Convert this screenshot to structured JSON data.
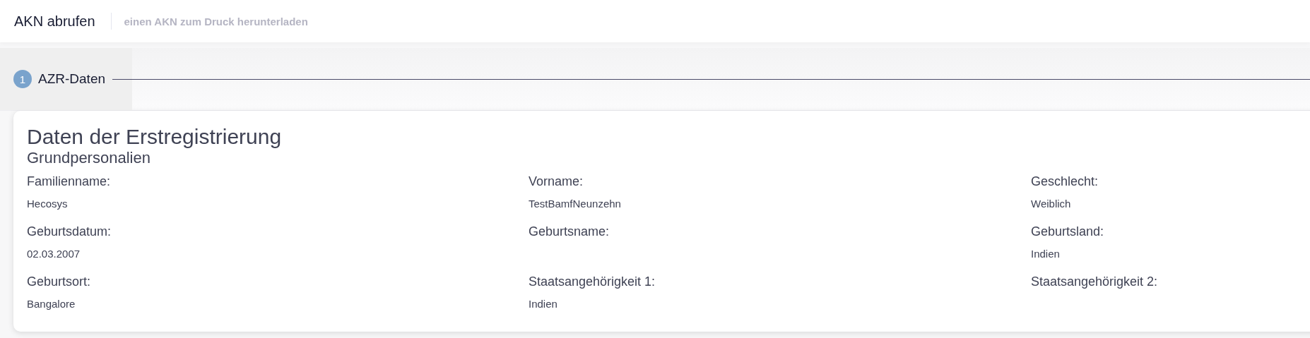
{
  "header": {
    "title": "AKN abrufen",
    "subtitle": "einen AKN zum Druck herunterladen"
  },
  "steps": [
    {
      "number": "1",
      "label": "AZR-Daten",
      "selected": true
    }
  ],
  "card": {
    "title": "Daten der Erstregistrierung",
    "section": "Grundpersonalien",
    "fields": [
      {
        "label": "Familienname:",
        "value": "Hecosys"
      },
      {
        "label": "Vorname:",
        "value": "TestBamfNeunzehn"
      },
      {
        "label": "Geschlecht:",
        "value": "Weiblich"
      },
      {
        "label": "Geburtsdatum:",
        "value": "02.03.2007"
      },
      {
        "label": "Geburtsname:"
      },
      {
        "label": "Geburtsland:",
        "value": "Indien"
      },
      {
        "label": "Geburtsort:",
        "value": "Bangalore"
      },
      {
        "label": "Staatsangehörigkeit 1:",
        "value": "Indien"
      },
      {
        "label": "Staatsangehörigkeit 2:"
      }
    ]
  }
}
